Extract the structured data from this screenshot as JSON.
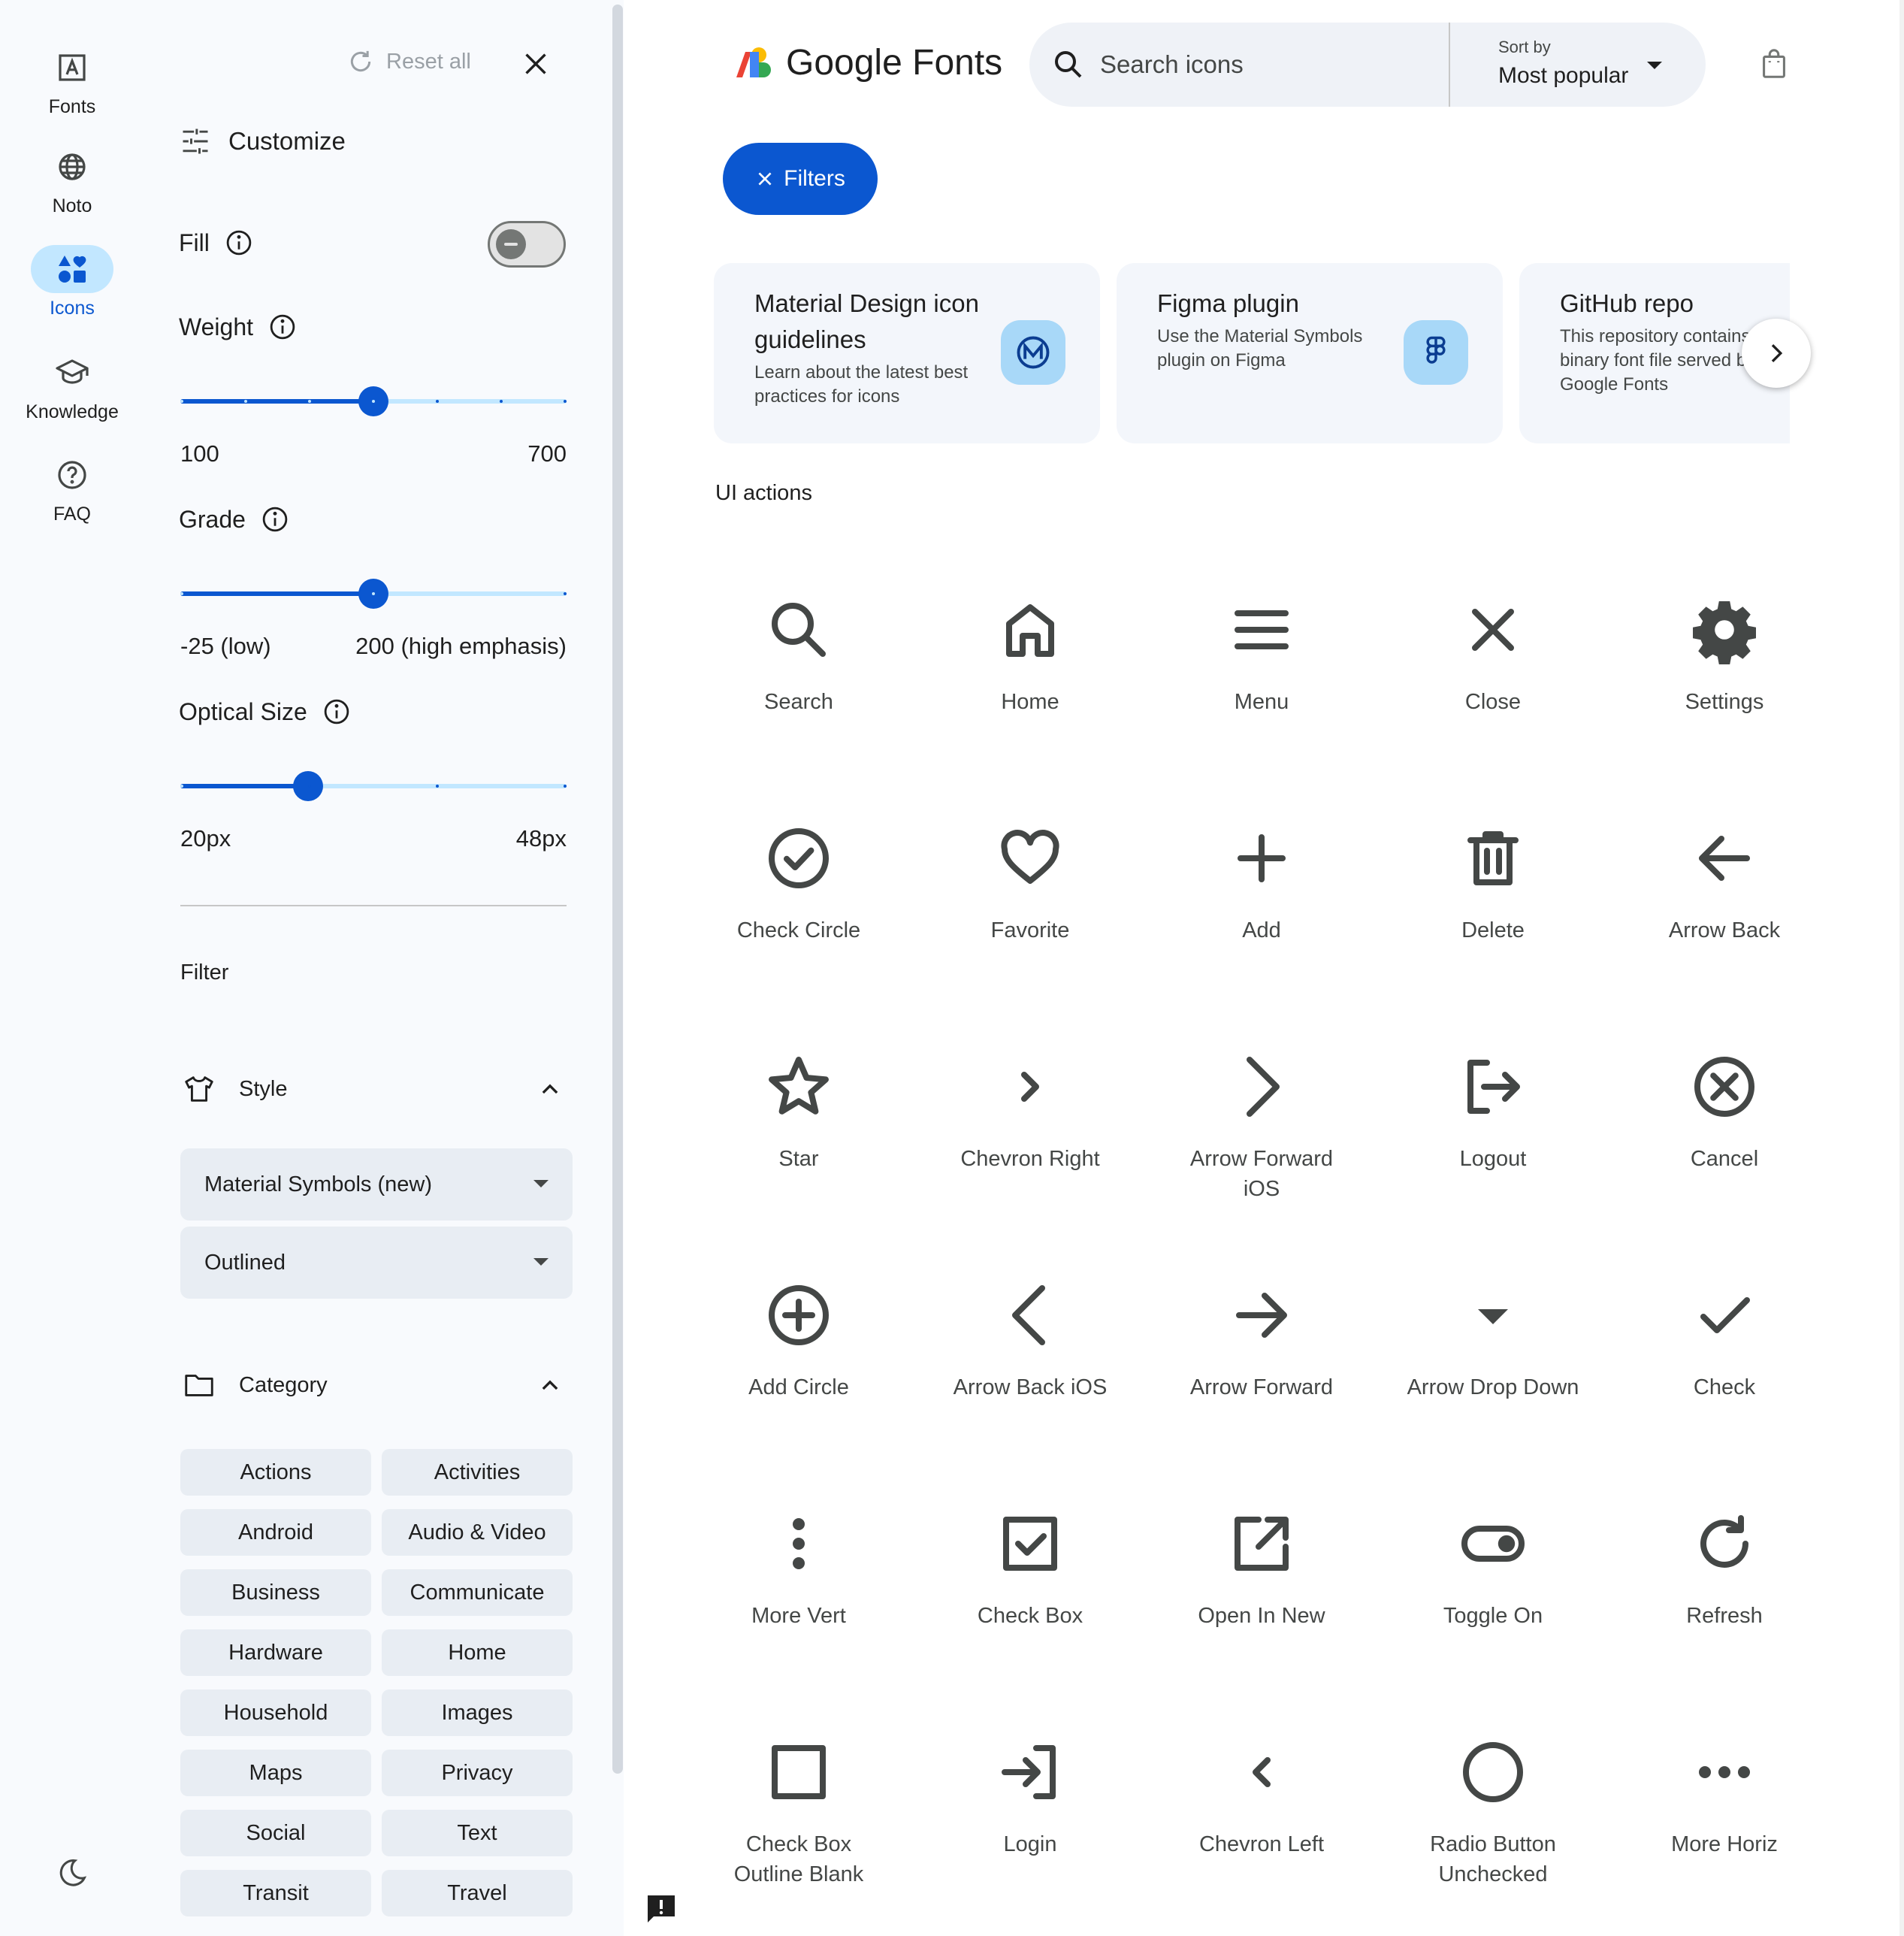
{
  "rail": {
    "items": [
      {
        "label": "Fonts",
        "icon": "font-icon"
      },
      {
        "label": "Noto",
        "icon": "globe-icon"
      },
      {
        "label": "Icons",
        "icon": "shapes-icon",
        "active": true
      },
      {
        "label": "Knowledge",
        "icon": "school-icon"
      },
      {
        "label": "FAQ",
        "icon": "help-icon"
      }
    ],
    "theme_icon": "dark-mode-icon"
  },
  "panel": {
    "reset_label": "Reset all",
    "customize_title": "Customize",
    "fill": {
      "label": "Fill",
      "on": false
    },
    "weight": {
      "label": "Weight",
      "min_label": "100",
      "max_label": "700",
      "value_fraction": 0.5
    },
    "grade": {
      "label": "Grade",
      "min_label": "-25 (low)",
      "max_label": "200 (high emphasis)",
      "value_fraction": 0.5
    },
    "optical_size": {
      "label": "Optical Size",
      "min_label": "20px",
      "max_label": "48px",
      "value_fraction": 0.33
    },
    "filter_heading": "Filter",
    "style": {
      "title": "Style",
      "family_select": "Material Symbols (new)",
      "variant_select": "Outlined"
    },
    "category": {
      "title": "Category",
      "chips": [
        "Actions",
        "Activities",
        "Android",
        "Audio & Video",
        "Business",
        "Communicate",
        "Hardware",
        "Home",
        "Household",
        "Images",
        "Maps",
        "Privacy",
        "Social",
        "Text",
        "Transit",
        "Travel"
      ]
    }
  },
  "header": {
    "logo_text": "Google Fonts",
    "search_placeholder": "Search icons",
    "sort_by_label": "Sort by",
    "sort_value": "Most popular"
  },
  "filters_button": "Filters",
  "cards": [
    {
      "title": "Material Design icon guidelines",
      "desc": "Learn about the latest best practices for icons"
    },
    {
      "title": "Figma plugin",
      "desc": "Use the Material Symbols plugin on Figma"
    },
    {
      "title": "GitHub repo",
      "desc": "This repository contains the binary font file served by Google Fonts"
    }
  ],
  "section_title": "UI actions",
  "icons": [
    {
      "label": "Search",
      "icon": "search"
    },
    {
      "label": "Home",
      "icon": "home"
    },
    {
      "label": "Menu",
      "icon": "menu"
    },
    {
      "label": "Close",
      "icon": "close"
    },
    {
      "label": "Settings",
      "icon": "settings"
    },
    {
      "label": "Check Circle",
      "icon": "check-circle"
    },
    {
      "label": "Favorite",
      "icon": "favorite"
    },
    {
      "label": "Add",
      "icon": "add"
    },
    {
      "label": "Delete",
      "icon": "delete"
    },
    {
      "label": "Arrow Back",
      "icon": "arrow-back"
    },
    {
      "label": "Star",
      "icon": "star"
    },
    {
      "label": "Chevron Right",
      "icon": "chevron-right"
    },
    {
      "label": "Arrow Forward iOS",
      "icon": "arrow-forward-ios"
    },
    {
      "label": "Logout",
      "icon": "logout"
    },
    {
      "label": "Cancel",
      "icon": "cancel"
    },
    {
      "label": "Add Circle",
      "icon": "add-circle"
    },
    {
      "label": "Arrow Back iOS",
      "icon": "arrow-back-ios"
    },
    {
      "label": "Arrow Forward",
      "icon": "arrow-forward"
    },
    {
      "label": "Arrow Drop Down",
      "icon": "arrow-drop-down"
    },
    {
      "label": "Check",
      "icon": "check"
    },
    {
      "label": "More Vert",
      "icon": "more-vert"
    },
    {
      "label": "Check Box",
      "icon": "check-box"
    },
    {
      "label": "Open In New",
      "icon": "open-in-new"
    },
    {
      "label": "Toggle On",
      "icon": "toggle-on"
    },
    {
      "label": "Refresh",
      "icon": "refresh"
    },
    {
      "label": "Check Box Outline Blank",
      "icon": "check-box-outline-blank"
    },
    {
      "label": "Login",
      "icon": "login"
    },
    {
      "label": "Chevron Left",
      "icon": "chevron-left"
    },
    {
      "label": "Radio Button Unchecked",
      "icon": "radio-button-unchecked"
    },
    {
      "label": "More Horiz",
      "icon": "more-horiz"
    }
  ],
  "colors": {
    "accent": "#0b57d0",
    "accent_light": "#c2e7ff",
    "panel_bg": "#f8fafd",
    "chip_bg": "#e8edf3",
    "icon_gray": "#444746"
  }
}
